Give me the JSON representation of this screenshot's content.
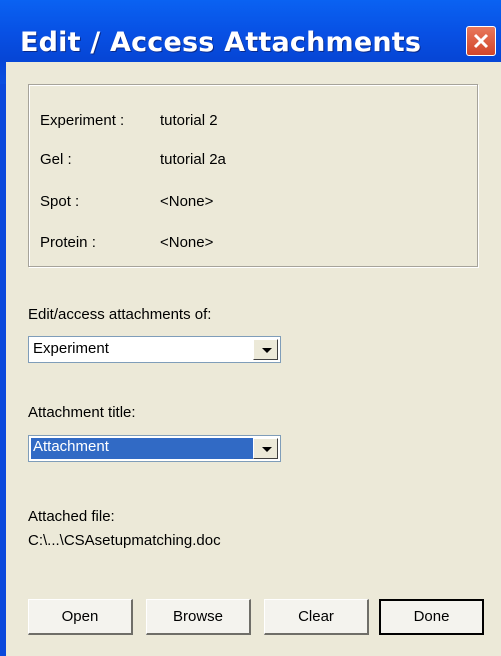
{
  "window": {
    "title": "Edit / Access Attachments"
  },
  "info": {
    "experiment_label": "Experiment :",
    "experiment_value": "tutorial 2",
    "gel_label": "Gel :",
    "gel_value": "tutorial 2a",
    "spot_label": "Spot :",
    "spot_value": "<None>",
    "protein_label": "Protein :",
    "protein_value": "<None>"
  },
  "attachments_of": {
    "label": "Edit/access attachments of:",
    "selected": "Experiment"
  },
  "attachment_title": {
    "label": "Attachment title:",
    "selected": "Attachment"
  },
  "attached_file": {
    "label": "Attached file:",
    "path": "C:\\...\\CSAsetupmatching.doc"
  },
  "buttons": {
    "open": "Open",
    "browse": "Browse",
    "clear": "Clear",
    "done": "Done"
  },
  "colors": {
    "titlebar": "#0a55e6",
    "close": "#d2452a",
    "dialog_bg": "#ece9d8",
    "selection": "#316ac5"
  }
}
